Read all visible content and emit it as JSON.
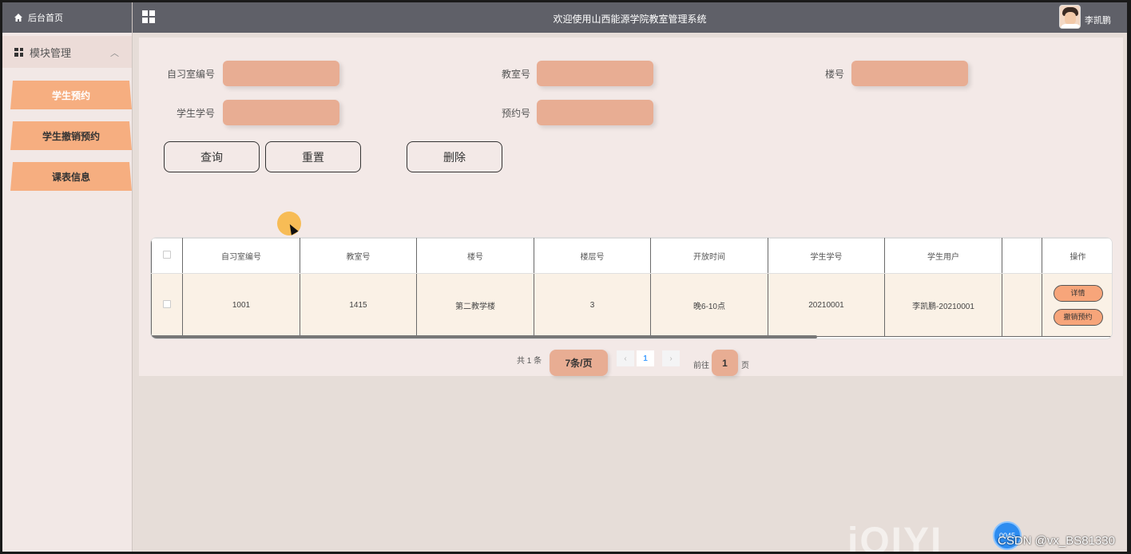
{
  "sidebar": {
    "home_label": "后台首页",
    "module_label": "模块管理",
    "items": [
      {
        "label": "学生预约",
        "active": true
      },
      {
        "label": "学生撤销预约",
        "active": false
      },
      {
        "label": "课表信息",
        "active": false
      }
    ]
  },
  "header": {
    "title": "欢迎使用山西能源学院教室管理系统",
    "username": "李凯鹏"
  },
  "search": {
    "fields": [
      {
        "label": "自习室编号",
        "value": ""
      },
      {
        "label": "教室号",
        "value": ""
      },
      {
        "label": "楼号",
        "value": ""
      },
      {
        "label": "学生学号",
        "value": ""
      },
      {
        "label": "预约号",
        "value": ""
      }
    ],
    "query_label": "查询",
    "reset_label": "重置",
    "delete_label": "删除"
  },
  "table": {
    "columns": [
      "自习室编号",
      "教室号",
      "楼号",
      "楼层号",
      "开放时间",
      "学生学号",
      "学生用户",
      "",
      "操作"
    ],
    "rows": [
      {
        "cells": [
          "1001",
          "1415",
          "第二教学楼",
          "3",
          "晚6-10点",
          "20210001",
          "李凯鹏-20210001",
          ""
        ],
        "actions": [
          "详情",
          "撤销预约"
        ]
      }
    ]
  },
  "pagination": {
    "total_text": "共 1 条",
    "page_size": "7条/页",
    "prev": "‹",
    "next": "›",
    "current_page": "1",
    "goto_label": "前往",
    "goto_value": "1",
    "page_suffix": "页"
  },
  "watermark": {
    "logo": "iQIYI",
    "badge": "0045",
    "text": "CSDN @vx_BS81330"
  },
  "colors": {
    "header_bg": "#5f6068",
    "accent": "#f6ae80",
    "input_bg": "#e8ad93",
    "panel_bg": "#f3e9e7"
  }
}
